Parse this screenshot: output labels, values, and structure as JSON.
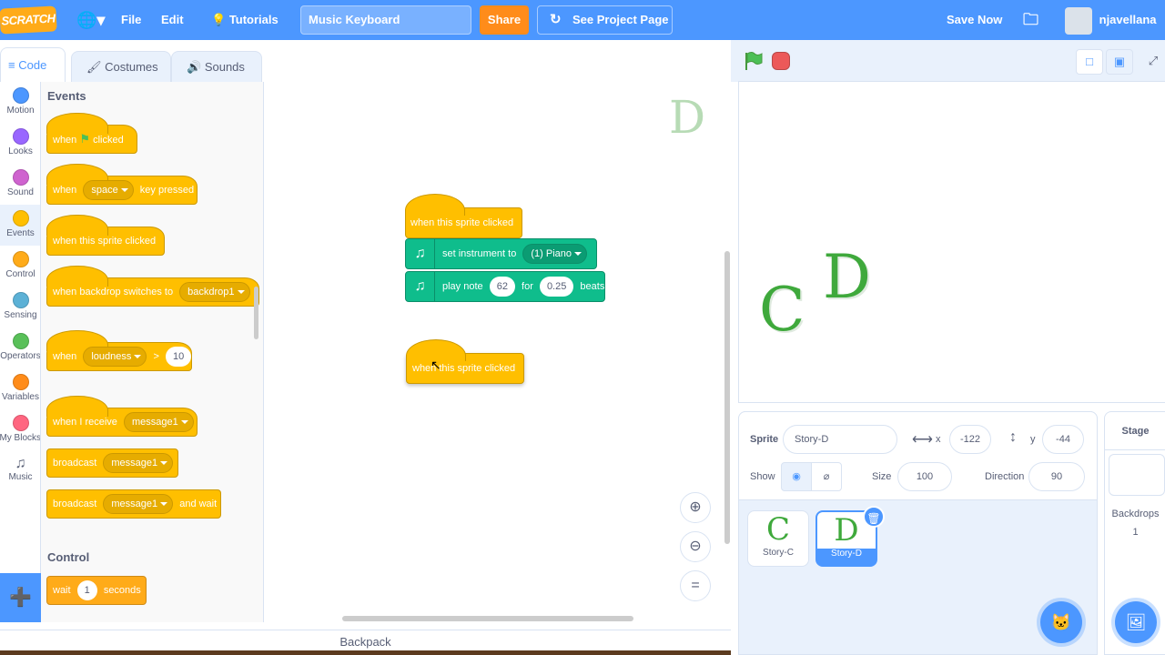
{
  "topbar": {
    "logo": "SCRATCH",
    "file": "File",
    "edit": "Edit",
    "tutorials": "Tutorials",
    "project_title": "Music Keyboard",
    "share": "Share",
    "see_project_page": "See Project Page",
    "save_now": "Save Now",
    "username": "njavellana"
  },
  "tabs": {
    "code": "Code",
    "costumes": "Costumes",
    "sounds": "Sounds"
  },
  "categories": [
    {
      "label": "Motion",
      "color": "#4c97ff"
    },
    {
      "label": "Looks",
      "color": "#9966ff"
    },
    {
      "label": "Sound",
      "color": "#cf63cf"
    },
    {
      "label": "Events",
      "color": "#ffbf00"
    },
    {
      "label": "Control",
      "color": "#ffab19"
    },
    {
      "label": "Sensing",
      "color": "#5cb1d6"
    },
    {
      "label": "Operators",
      "color": "#59c059"
    },
    {
      "label": "Variables",
      "color": "#ff8c1a"
    },
    {
      "label": "My Blocks",
      "color": "#ff6680"
    },
    {
      "label": "Music",
      "color": "#0fbd8c"
    }
  ],
  "palette": {
    "events_header": "Events",
    "when": "when",
    "clicked": "clicked",
    "space": "space",
    "key_pressed": "key pressed",
    "when_sprite_clicked": "when this sprite clicked",
    "when_backdrop_switches_to": "when backdrop switches to",
    "backdrop1": "backdrop1",
    "loudness": "loudness",
    "gt": ">",
    "loudness_value": "10",
    "when_i_receive": "when I receive",
    "message1": "message1",
    "broadcast": "broadcast",
    "and_wait": "and wait",
    "control_header": "Control",
    "wait": "wait",
    "wait_value": "1",
    "seconds": "seconds"
  },
  "workspace": {
    "script1_hat": "when this sprite clicked",
    "set_instrument_to": "set instrument to",
    "instrument": "(1) Piano",
    "play_note": "play note",
    "note": "62",
    "for": "for",
    "beats_value": "0.25",
    "beats": "beats",
    "script2_hat": "when this sprite clicked",
    "ghost_sprite": "D"
  },
  "backpack": "Backpack",
  "stage": {
    "sprite_c": "C",
    "sprite_d": "D"
  },
  "sprite_info": {
    "sprite_label": "Sprite",
    "sprite_name": "Story-D",
    "x_label": "x",
    "x": "-122",
    "y_label": "y",
    "y": "-44",
    "show_label": "Show",
    "size_label": "Size",
    "size": "100",
    "direction_label": "Direction",
    "direction": "90"
  },
  "sprites": [
    {
      "glyph": "C",
      "name": "Story-C",
      "selected": false
    },
    {
      "glyph": "D",
      "name": "Story-D",
      "selected": true
    }
  ],
  "stage_pane": {
    "title": "Stage",
    "backdrops_label": "Backdrops",
    "backdrops_count": "1"
  }
}
